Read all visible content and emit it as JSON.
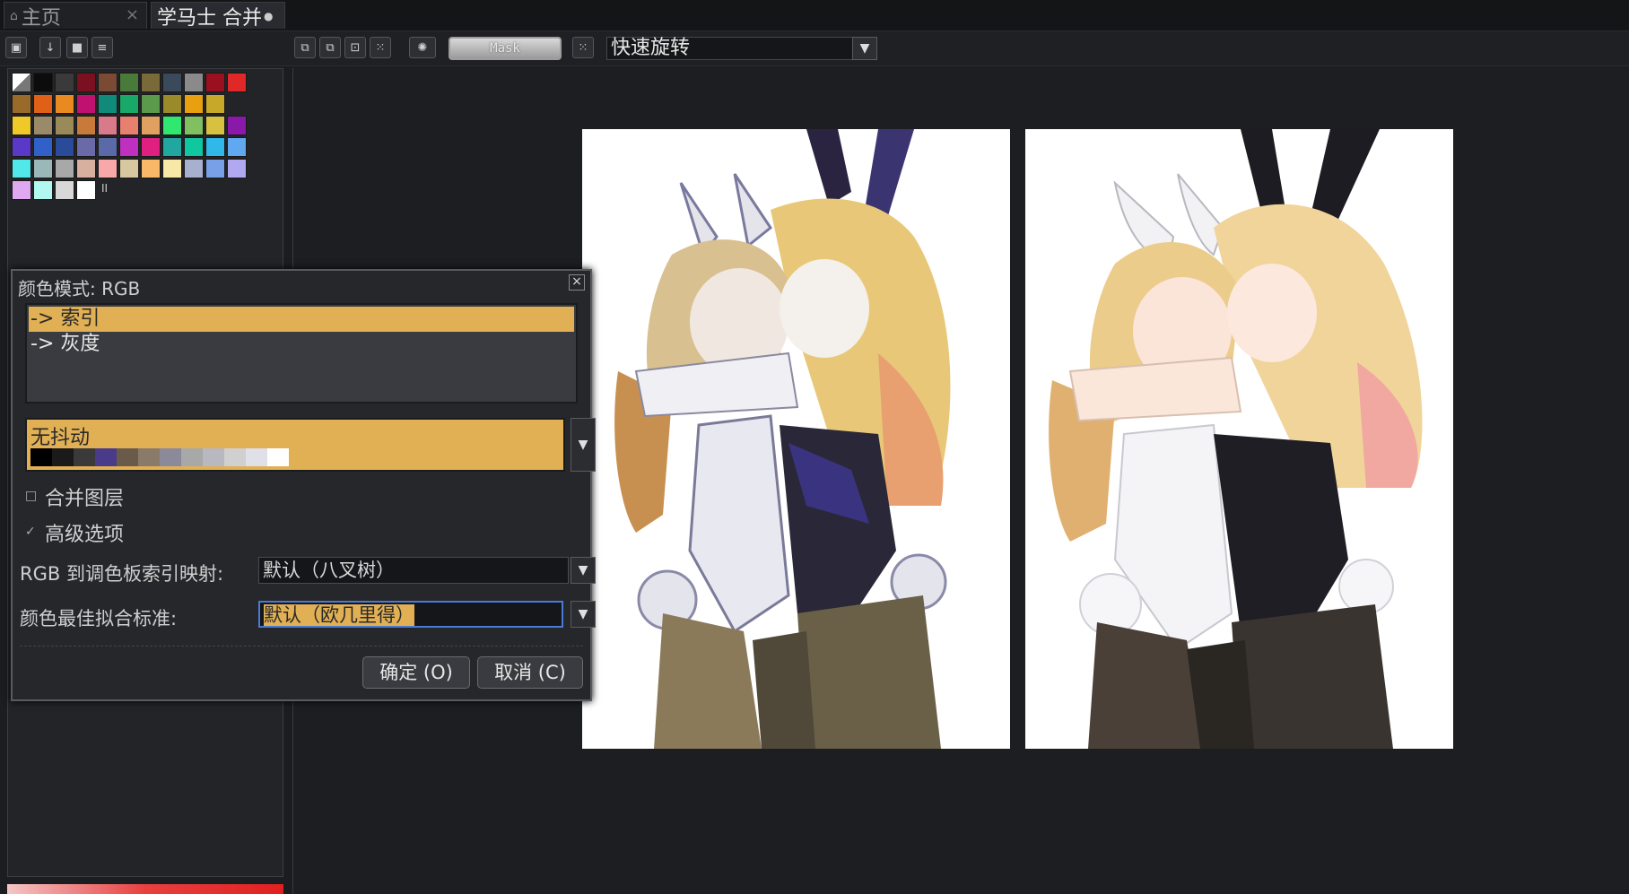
{
  "tabs": [
    {
      "label": "主页",
      "active": false,
      "close": "×"
    },
    {
      "label": "学马士 合并",
      "active": true,
      "modified_dot": "●"
    }
  ],
  "toolbar": {
    "mask_label": "Mask",
    "quick_action": {
      "value": "快速旋转",
      "arrow": "▼"
    }
  },
  "palette": {
    "colors": [
      "#c8c8c8",
      "#0c0c0c",
      "#3a3a3a",
      "#7a1020",
      "#7a4a34",
      "#4a7a3a",
      "#7a6a3a",
      "#3a4a5a",
      "#8a8a8a",
      "#9a1020",
      "#e02828",
      "#9a6a2a",
      "#e06018",
      "#e88a20",
      "#c01070",
      "#108a7a",
      "#18a868",
      "#5a9a4a",
      "#9a8a2a",
      "#e8a010",
      "#c8a828",
      "",
      "#f0c828",
      "#9a8a6a",
      "#9a8a5a",
      "#c87a3a",
      "#d87a8a",
      "#e88070",
      "#e0a060",
      "#30e870",
      "#80c060",
      "#d8c040",
      "#8a18a8",
      "#5a38c8",
      "#3060c8",
      "#2a4a9a",
      "#6a6aa8",
      "#5a6aa8",
      "#c030c0",
      "#e02080",
      "#20a8a0",
      "#10c8a0",
      "#30b8e8",
      "#60a8f0",
      "#50e8e8",
      "#9ab8b8",
      "#a8a8a8",
      "#d8b0a0",
      "#f8a8a8",
      "#d8c8a0",
      "#f8b868",
      "#f8e8a8",
      "#a8b0d0",
      "#78a0e8",
      "#b0a8f0",
      "#e0a8f0",
      "#b0f8f0",
      "#d8d8d8",
      "#ffffff"
    ],
    "mini_marker": "II"
  },
  "dialog": {
    "title": "颜色模式: RGB",
    "close_icon": "×",
    "mode_options": [
      {
        "label": "-> 索引",
        "selected": true
      },
      {
        "label": "-> 灰度",
        "selected": false
      }
    ],
    "dither": {
      "label": "无抖动",
      "arrow": "▼"
    },
    "dither_ramp": [
      "#000000",
      "#1a1a1a",
      "#3a3a3a",
      "#4a3a8a",
      "#6a5a4a",
      "#8a7a6a",
      "#8a8a9a",
      "#a8a8a8",
      "#b8b8c0",
      "#d0d0d0",
      "#e0e0e8",
      "#ffffff"
    ],
    "merge_layers": {
      "label": "合并图层",
      "checked": false
    },
    "advanced": {
      "label": "高级选项",
      "checked": true,
      "check_mark": "✓"
    },
    "mapping": {
      "label": "RGB 到调色板索引映射:",
      "value": "默认（八叉树）",
      "arrow": "▼"
    },
    "fit": {
      "label": "颜色最佳拟合标准:",
      "value": "默认（欧几里得）",
      "arrow": "▼"
    },
    "ok_label": "确定 (O)",
    "cancel_label": "取消 (C)"
  },
  "colors": {
    "accent": "#e2b054",
    "background": "#1c1d20",
    "panel": "#26272b"
  }
}
